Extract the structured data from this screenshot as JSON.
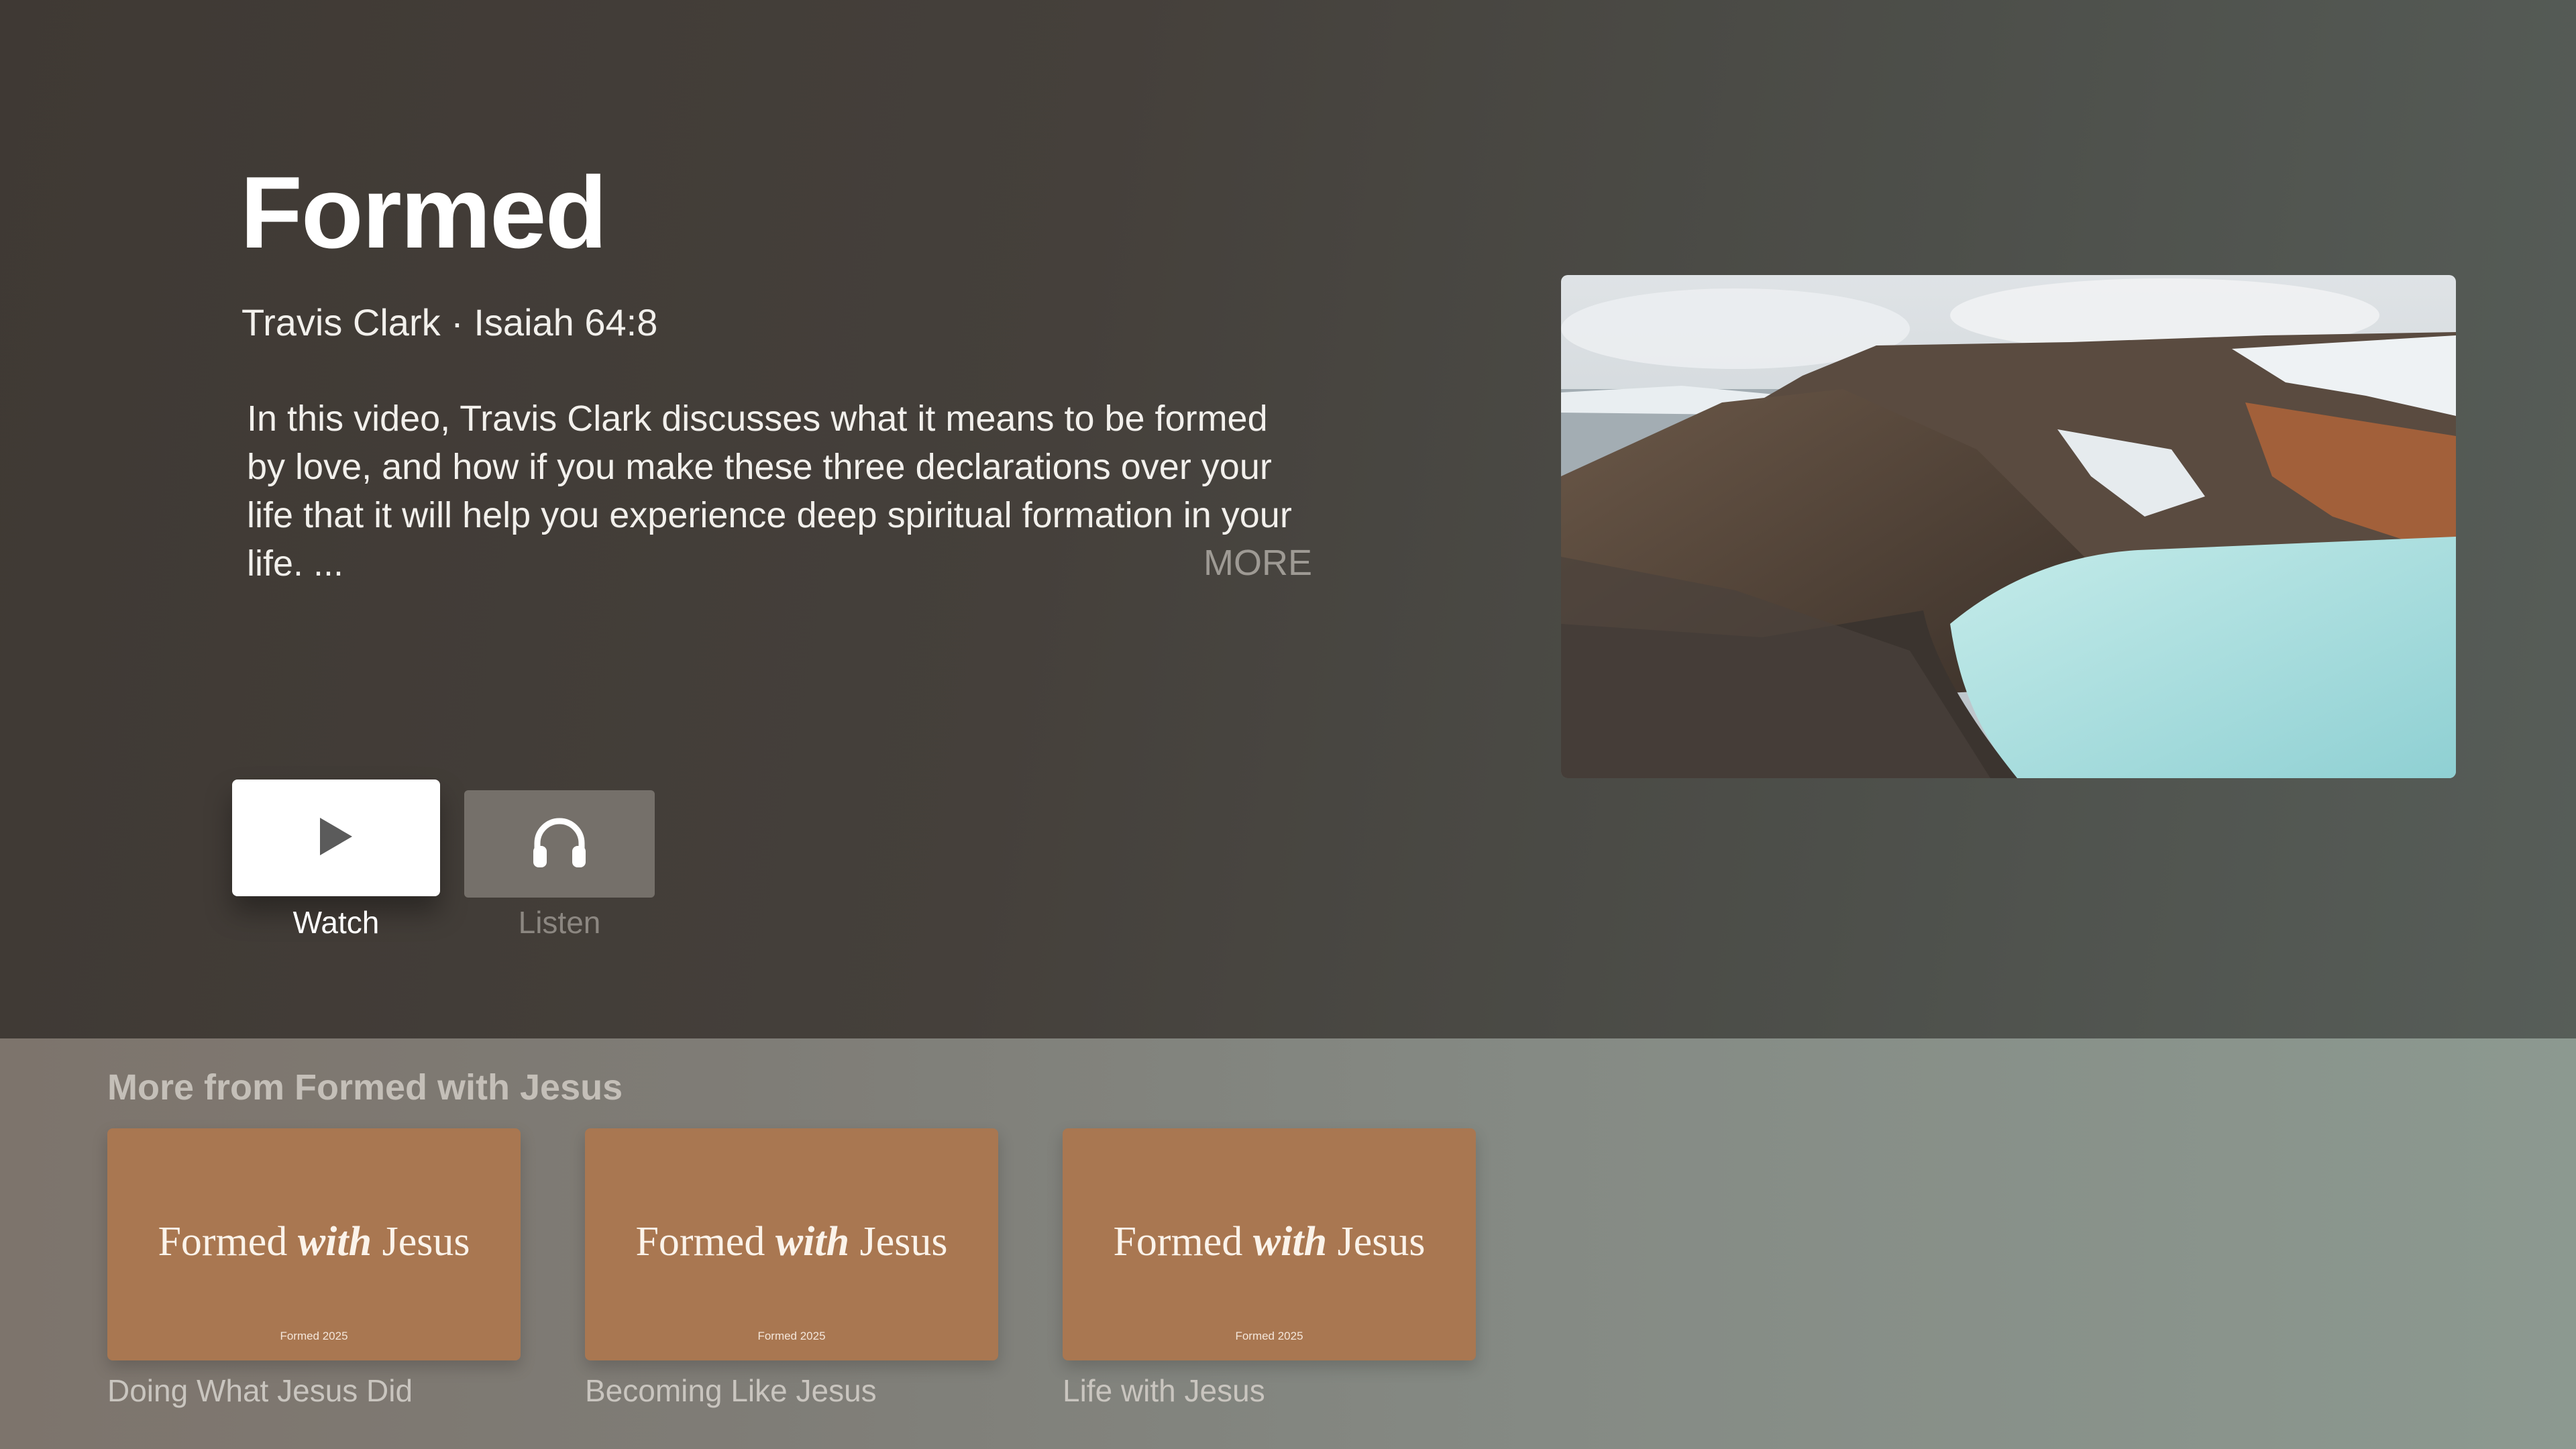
{
  "header": {
    "title": "Formed",
    "subtitle": "Travis Clark · Isaiah 64:8",
    "description": "In this video, Travis Clark discusses what it means to be formed by love, and how if you make these three declarations over your life that it will help you experience deep spiritual formation in your life. ...",
    "more_label": "MORE"
  },
  "actions": {
    "watch_label": "Watch",
    "watch_icon": "play-icon",
    "listen_label": "Listen",
    "listen_icon": "headphones-icon"
  },
  "shelf": {
    "title": "More from Formed with Jesus",
    "items": [
      {
        "title_pre": "Formed ",
        "title_em": "with",
        "title_post": " Jesus",
        "footnote": "Formed 2025",
        "label": "Doing What Jesus Did"
      },
      {
        "title_pre": "Formed ",
        "title_em": "with",
        "title_post": " Jesus",
        "footnote": "Formed 2025",
        "label": "Becoming Like Jesus"
      },
      {
        "title_pre": "Formed ",
        "title_em": "with",
        "title_post": " Jesus",
        "footnote": "Formed 2025",
        "label": "Life with Jesus"
      }
    ]
  },
  "colors": {
    "card_brand": "#a97751",
    "water": "#a9dede"
  }
}
